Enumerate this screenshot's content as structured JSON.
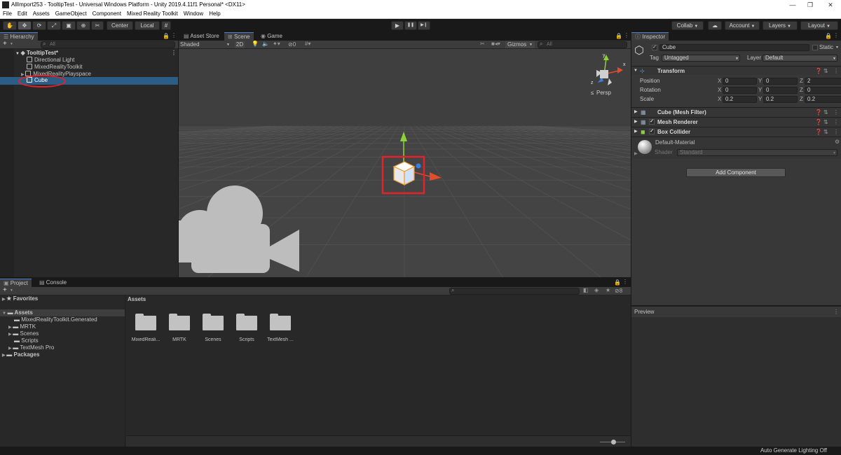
{
  "window": {
    "title": "AllImport253 - TooltipTest - Universal Windows Platform - Unity 2019.4.11f1 Personal* <DX11>",
    "minimize": "—",
    "restore": "❐",
    "close": "✕"
  },
  "menu": [
    "File",
    "Edit",
    "Assets",
    "GameObject",
    "Component",
    "Mixed Reality Toolkit",
    "Window",
    "Help"
  ],
  "toolbar": {
    "tools": [
      "✋",
      "✥",
      "⟳",
      "⤢",
      "▣",
      "⊕",
      "✂"
    ],
    "pivot": "Center",
    "space": "Local",
    "play": "▶",
    "pause": "❚❚",
    "step": "▶❙",
    "collab": "Collab",
    "account": "Account",
    "layers": "Layers",
    "layout": "Layout",
    "cloud_icon": "cloud-icon"
  },
  "hierarchy": {
    "tab": "Hierarchy",
    "add": "+",
    "search_placeholder": "All",
    "scene": "TooltipTest*",
    "items": [
      "Directional Light",
      "MixedRealityToolkit",
      "MixedRealityPlayspace",
      "Cube"
    ],
    "selected": "Cube"
  },
  "scene_view": {
    "tabs": [
      "Asset Store",
      "Scene",
      "Game"
    ],
    "shading": "Shaded",
    "mode_2d": "2D",
    "hidden_count": "0",
    "gizmos": "Gizmos",
    "search_placeholder": "All",
    "projection": "Persp",
    "axis_labels": {
      "y": "y",
      "x": "x",
      "z": "z"
    }
  },
  "inspector": {
    "tab": "Inspector",
    "object_name": "Cube",
    "static_label": "Static",
    "tag_label": "Tag",
    "tag_value": "Untagged",
    "layer_label": "Layer",
    "layer_value": "Default",
    "transform": {
      "title": "Transform",
      "rows": [
        {
          "label": "Position",
          "x": "0",
          "y": "0",
          "z": "2"
        },
        {
          "label": "Rotation",
          "x": "0",
          "y": "0",
          "z": "0"
        },
        {
          "label": "Scale",
          "x": "0.2",
          "y": "0.2",
          "z": "0.2"
        }
      ],
      "axis": [
        "X",
        "Y",
        "Z"
      ]
    },
    "components": [
      "Cube (Mesh Filter)",
      "Mesh Renderer",
      "Box Collider"
    ],
    "material": {
      "name": "Default-Material",
      "shader_label": "Shader",
      "shader_value": "Standard"
    },
    "add_component": "Add Component"
  },
  "project": {
    "tabs": [
      "Project",
      "Console"
    ],
    "add": "+",
    "favorites": "Favorites",
    "assets_root": "Assets",
    "tree": [
      "MixedRealityToolkit.Generated",
      "MRTK",
      "Scenes",
      "Scripts",
      "TextMesh Pro"
    ],
    "packages": "Packages",
    "assets_header": "Assets",
    "hidden_count": "8",
    "folders": [
      "MixedReali...",
      "MRTK",
      "Scenes",
      "Scripts",
      "TextMesh ..."
    ]
  },
  "preview": {
    "title": "Preview"
  },
  "statusbar": {
    "text": "Auto Generate Lighting Off"
  },
  "colors": {
    "selection": "#2c5d87",
    "annotation_red": "#e0242b",
    "axis_x": "#e14c2a",
    "axis_y": "#8dd13a",
    "axis_z": "#3c7de0"
  }
}
